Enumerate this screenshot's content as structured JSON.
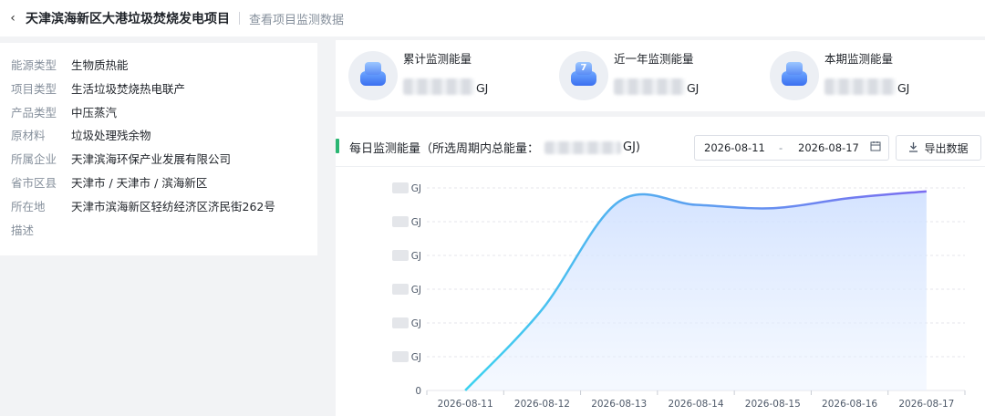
{
  "header": {
    "back_icon": "chevron-left-icon",
    "title": "天津滨海新区大港垃圾焚烧发电项目",
    "subtitle": "查看项目监测数据"
  },
  "info": [
    {
      "label": "能源类型",
      "value": "生物质热能"
    },
    {
      "label": "项目类型",
      "value": "生活垃圾焚烧热电联产"
    },
    {
      "label": "产品类型",
      "value": "中压蒸汽"
    },
    {
      "label": "原材料",
      "value": "垃圾处理残余物"
    },
    {
      "label": "所属企业",
      "value": "天津滨海环保产业发展有限公司"
    },
    {
      "label": "省市区县",
      "value": "天津市 / 天津市 / 滨海新区"
    },
    {
      "label": "所在地",
      "value": "天津市滨海新区轻纺经济区济民街262号"
    },
    {
      "label": "描述",
      "value": ""
    }
  ],
  "stats": [
    {
      "label": "累计监测能量",
      "unit": "GJ",
      "icon": "energy-cylinder-icon"
    },
    {
      "label": "近一年监测能量",
      "unit": "GJ",
      "icon": "calendar-7-icon"
    },
    {
      "label": "本期监测能量",
      "unit": "GJ",
      "icon": "energy-stack-icon"
    }
  ],
  "chart_section": {
    "title_prefix": "每日监测能量（所选周期内总能量：",
    "title_suffix": "GJ)",
    "date_start": "2026-08-11",
    "date_sep": "-",
    "date_end": "2026-08-17",
    "calendar_icon": "calendar-icon",
    "export_label": "导出数据",
    "export_icon": "download-icon"
  },
  "chart_data": {
    "type": "area",
    "x": [
      "2026-08-11",
      "2026-08-12",
      "2026-08-13",
      "2026-08-14",
      "2026-08-15",
      "2026-08-16",
      "2026-08-17"
    ],
    "y_unit": "GJ",
    "y_tick_labels": [
      "0",
      "GJ",
      "GJ",
      "GJ",
      "GJ",
      "GJ",
      "GJ"
    ],
    "y_tick_values_hidden": true,
    "series": [
      {
        "values": [
          0,
          2.4,
          5.6,
          5.5,
          5.4,
          5.7,
          5.9
        ]
      }
    ],
    "ylim": [
      0,
      6
    ],
    "grid": true,
    "colors": {
      "line_start": "#3ed3f0",
      "line_end": "#7b6cf0",
      "fill": "#dbe9ff"
    }
  }
}
